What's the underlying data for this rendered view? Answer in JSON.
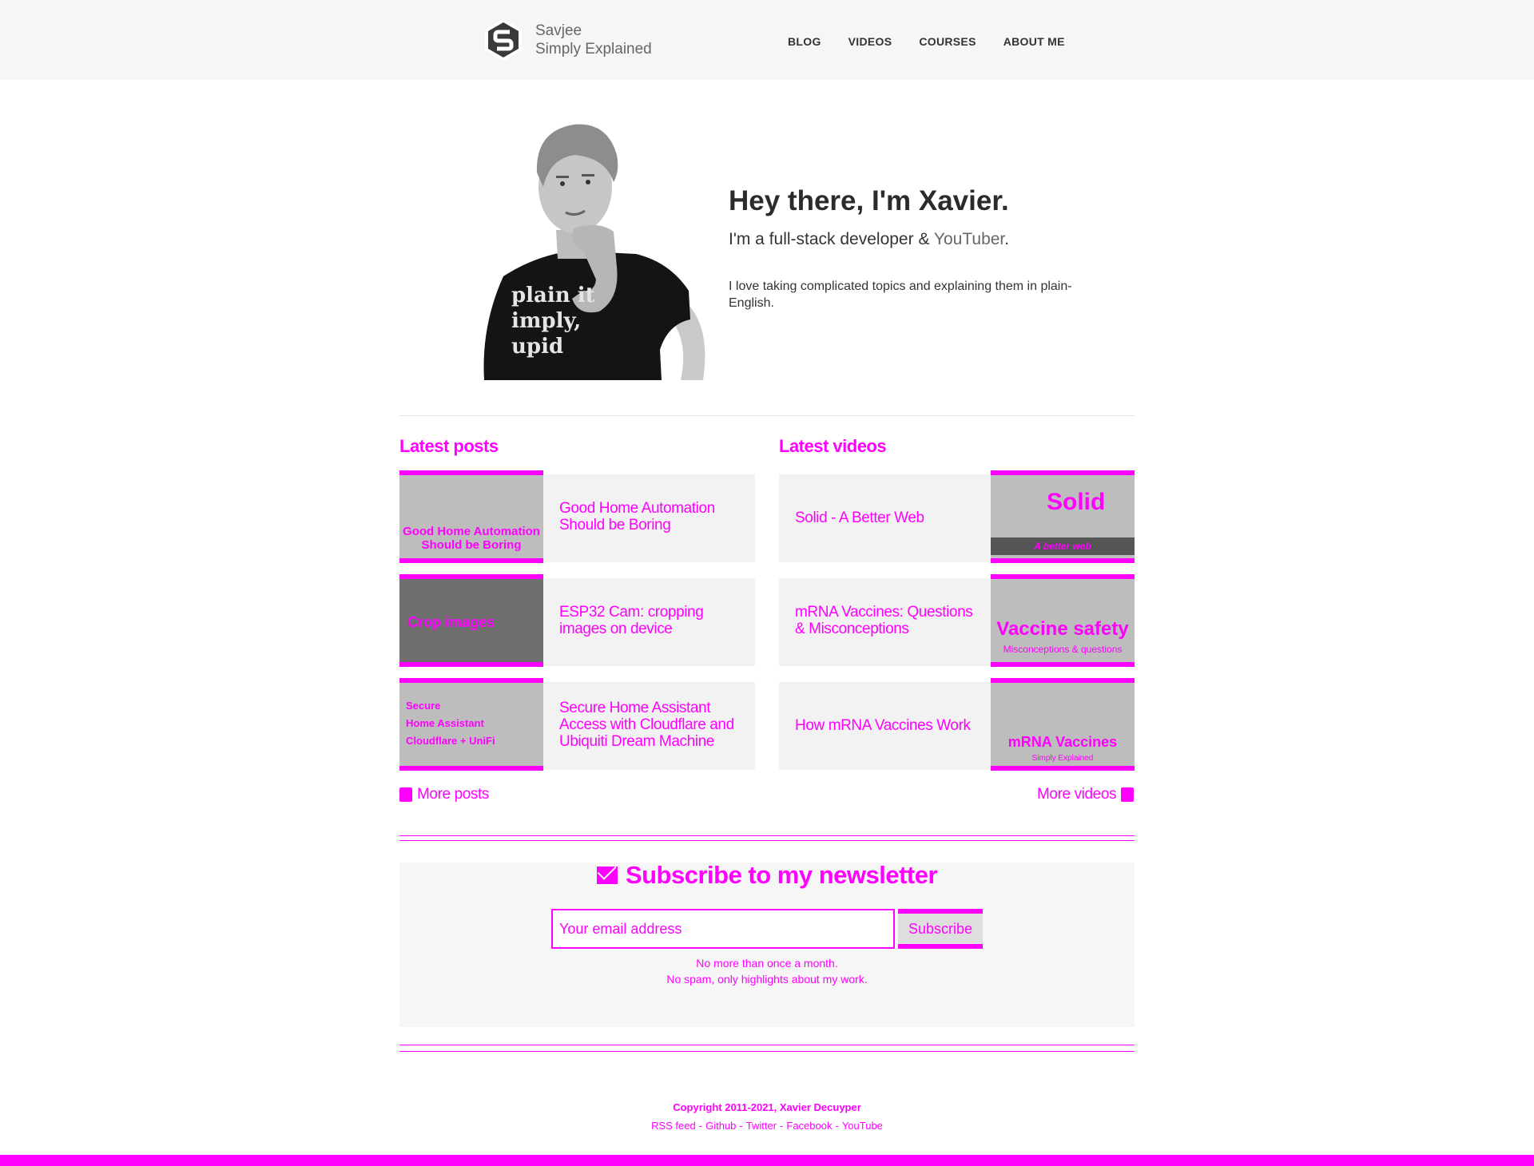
{
  "header": {
    "brand_name": "Savjee",
    "brand_tagline": "Simply Explained",
    "nav": [
      "BLOG",
      "VIDEOS",
      "COURSES",
      "ABOUT ME"
    ]
  },
  "hero": {
    "title": "Hey there, I'm Xavier.",
    "subtitle_prefix": "I'm a full-stack developer & ",
    "subtitle_link": "YouTuber",
    "subtitle_suffix": ".",
    "description": "I love taking complicated topics and explaining them in plain-English.",
    "shirt_text": "plain it\nimply,\nupid"
  },
  "posts": {
    "heading": "Latest posts",
    "items": [
      {
        "title": "Good Home Automation Should be Boring",
        "thumb_text": "Good Home Automation\nShould be Boring"
      },
      {
        "title": "ESP32 Cam: cropping images on device",
        "thumb_text": "Crop images"
      },
      {
        "title": "Secure Home Assistant Access with Cloudflare and Ubiquiti Dream Machine",
        "thumb_text": "Secure\nHome Assistant\nCloudflare + UniFi"
      }
    ],
    "more": "More posts"
  },
  "videos": {
    "heading": "Latest videos",
    "items": [
      {
        "title": "Solid - A Better Web",
        "thumb_text": "Solid",
        "thumb_sub": "A better web"
      },
      {
        "title": "mRNA Vaccines: Questions & Misconceptions",
        "thumb_text": "Vaccine safety",
        "thumb_sub": "Misconceptions & questions"
      },
      {
        "title": "How mRNA Vaccines Work",
        "thumb_text": "mRNA Vaccines",
        "thumb_sub": "Simply Explained"
      }
    ],
    "more": "More videos"
  },
  "newsletter": {
    "title": "Subscribe to my newsletter",
    "placeholder": "Your email address",
    "button": "Subscribe",
    "note_line1": "No more than once a month.",
    "note_line2": "No spam, only highlights about my work."
  },
  "footer": {
    "copyright": "Copyright 2011-2021, Xavier Decuyper",
    "links": [
      "RSS feed",
      "Github",
      "Twitter",
      "Facebook",
      "YouTube"
    ],
    "separator": "-"
  },
  "colors": {
    "accent": "#ff00ff",
    "header_bg": "#f6f6f6",
    "card_bg": "#f2f2f2",
    "text": "#333333"
  },
  "icons": [
    "savjee-logo-icon",
    "post-icon",
    "video-icon",
    "mail-icon"
  ]
}
